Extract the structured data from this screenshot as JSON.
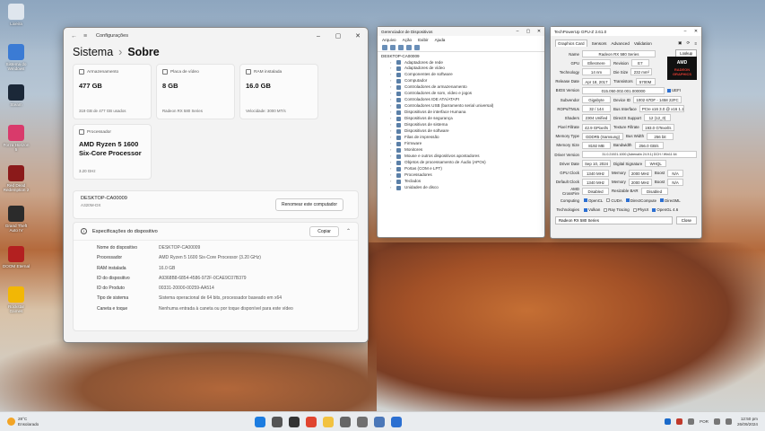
{
  "desktop": {
    "icons": [
      {
        "label": "Lixeira",
        "color": "#dfe6ee"
      },
      {
        "label": "Sistema do Windows",
        "color": "#3b7bd4"
      },
      {
        "label": "Steam",
        "color": "#1b2838"
      },
      {
        "label": "Forza Horizon 5",
        "color": "#d93a6b"
      },
      {
        "label": "Red Dead Redemption 2",
        "color": "#8b1a1a"
      },
      {
        "label": "Grand Theft Auto IV",
        "color": "#2b2b2b"
      },
      {
        "label": "DOOM Eternal",
        "color": "#b32020"
      },
      {
        "label": "Rockstar Games",
        "color": "#f2b705"
      }
    ]
  },
  "settings": {
    "window_title": "Configurações",
    "breadcrumb_parent": "Sistema",
    "breadcrumb_sep": "›",
    "breadcrumb_current": "Sobre",
    "tiles": [
      {
        "header": "Armazenamento",
        "value": "477 GB",
        "sub": "319 GB de 477 GB usados"
      },
      {
        "header": "Placa de vídeo",
        "value": "8 GB",
        "sub": "Radeon RX 580 Series"
      },
      {
        "header": "RAM instalada",
        "value": "16.0 GB",
        "sub": "Velocidade: 3000 MT/s"
      },
      {
        "header": "Processador",
        "value": "AMD Ryzen 5 1600 Six-Core Processor",
        "sub": "3.20 GHz"
      }
    ],
    "pc": {
      "name": "DESKTOP-CA00009",
      "model": "A320M-DX",
      "rename_button": "Renomear este computador"
    },
    "specs": {
      "title": "Especificações do dispositivo",
      "copy_button": "Copiar",
      "rows": [
        {
          "key": "Nome do dispositivo",
          "value": "DESKTOP-CA00009"
        },
        {
          "key": "Processador",
          "value": "AMD Ryzen 5 1600 Six-Core Processor    (3.20 GHz)"
        },
        {
          "key": "RAM instalada",
          "value": "16.0 GB"
        },
        {
          "key": "ID do dispositivo",
          "value": "A9368B8-6854-4586-972F-0CAE9C07B379"
        },
        {
          "key": "ID do Produto",
          "value": "00331-20000-00259-AA514"
        },
        {
          "key": "Tipo de sistema",
          "value": "Sistema operacional de 64 bits, processador baseado em x64"
        },
        {
          "key": "Caneta e toque",
          "value": "Nenhuma entrada à caneta ou por toque disponível para este vídeo"
        }
      ]
    }
  },
  "device_manager": {
    "title": "Gerenciador de Dispositivos",
    "menu": [
      "Arquivo",
      "Ação",
      "Exibir",
      "Ajuda"
    ],
    "root": "DESKTOP-CA00009",
    "items": [
      "Adaptadores de rede",
      "Adaptadores de vídeo",
      "Componentes de software",
      "Computador",
      "Controladores de armazenamento",
      "Controladores de som, vídeo e jogos",
      "Controladores IDE ATA/ATAPI",
      "Controladores USB (barramento serial universal)",
      "Dispositivos de interface Humana",
      "Dispositivos de segurança",
      "Dispositivos de sistema",
      "Dispositivos de software",
      "Filas de impressão",
      "Firmware",
      "Monitores",
      "Mouse e outros dispositivos apontadores",
      "Objetos de processamento de Áudio (APOs)",
      "Portas (COM e LPT)",
      "Processadores",
      "Teclados",
      "Unidades de disco"
    ]
  },
  "gpuz": {
    "title": "TechPowerUp GPU-Z 2.61.0",
    "tabs": [
      "Graphics Card",
      "Sensors",
      "Advanced",
      "Validation"
    ],
    "lookup_button": "Lookup",
    "logo_text": "AMD",
    "logo_sub": "RADEON GRAPHICS",
    "name": "Radeon RX 580 Series",
    "gpu": "Ellesmere",
    "revision": "E7",
    "technology": "14 nm",
    "die_size": "232 mm²",
    "release_date": "Apr 18, 2017",
    "transistors": "5700M",
    "bios_version": "015.050.002.001.000000",
    "uefi": "UEFI",
    "subvendor": "Gigabyte",
    "device_id": "1002 67DF - 1458 22FC",
    "rops_tmus": "32 / 144",
    "bus_interface": "PCIe x16 3.0 @ x16 1.1",
    "shaders": "2304 Unified",
    "directx": "12 (12_0)",
    "pixel_fillrate": "42.9 GPixel/s",
    "texture_fillrate": "193.0 GTexel/s",
    "memory_type": "GDDR5 (Samsung)",
    "bus_width": "256 bit",
    "memory_size": "8192 MB",
    "bandwidth": "256.0 GB/s",
    "driver_version": "31.0.21921.1000 (Adrenalin 24.9.1) DCH / Win11 64",
    "driver_date": "Sep 10, 2024",
    "digital_signature": "WHQL",
    "gpu_clock": "1340 MHz",
    "memory_clock": "2000 MHz",
    "boost": "N/A",
    "default_clock": "1340 MHz",
    "default_memory": "2000 MHz",
    "default_boost": "N/A",
    "crossfire": "Disabled",
    "resizable_bar": "Disabled",
    "computing": [
      "OpenCL",
      "CUDA",
      "DirectCompute",
      "DirectML"
    ],
    "technologies": [
      "Vulkan",
      "Ray Tracing",
      "PhysX",
      "OpenGL 4.6"
    ],
    "footer_select": "Radeon RX 580 Series",
    "close_button": "Close",
    "labels": {
      "name": "Name",
      "gpu": "GPU",
      "revision": "Revision",
      "technology": "Technology",
      "die_size": "Die Size",
      "release_date": "Release Date",
      "transistors": "Transistors",
      "bios": "BIOS Version",
      "subvendor": "Subvendor",
      "device_id": "Device ID",
      "rops": "ROPs/TMUs",
      "bus": "Bus Interface",
      "shaders": "Shaders",
      "directx": "DirectX Support",
      "pixel": "Pixel Fillrate",
      "texture": "Texture Fillrate",
      "mem_type": "Memory Type",
      "bus_width": "Bus Width",
      "mem_size": "Memory Size",
      "bandwidth": "Bandwidth",
      "driver": "Driver Version",
      "driver_date": "Driver Date",
      "sig": "Digital Signature",
      "gpu_clock": "GPU Clock",
      "memory": "Memory",
      "boost": "Boost",
      "default_clock": "Default Clock",
      "crossfire": "AMD CrossFire",
      "rebar": "Resizable BAR",
      "computing": "Computing",
      "tech": "Technologies"
    }
  },
  "taskbar": {
    "weather_temp": "28°C",
    "weather_desc": "Ensolarado",
    "lang": "POR",
    "time": "12:50 pm",
    "date": "26/09/2024",
    "apps": [
      {
        "name": "start",
        "color": "#1c7ce0"
      },
      {
        "name": "search",
        "color": "#555"
      },
      {
        "name": "task-view",
        "color": "#333"
      },
      {
        "name": "chrome",
        "color": "#e0442f"
      },
      {
        "name": "explorer",
        "color": "#f2c240"
      },
      {
        "name": "gpuz",
        "color": "#666"
      },
      {
        "name": "settings",
        "color": "#707070"
      },
      {
        "name": "devmgr",
        "color": "#4b77b8"
      },
      {
        "name": "store",
        "color": "#2b6fd1"
      }
    ]
  }
}
